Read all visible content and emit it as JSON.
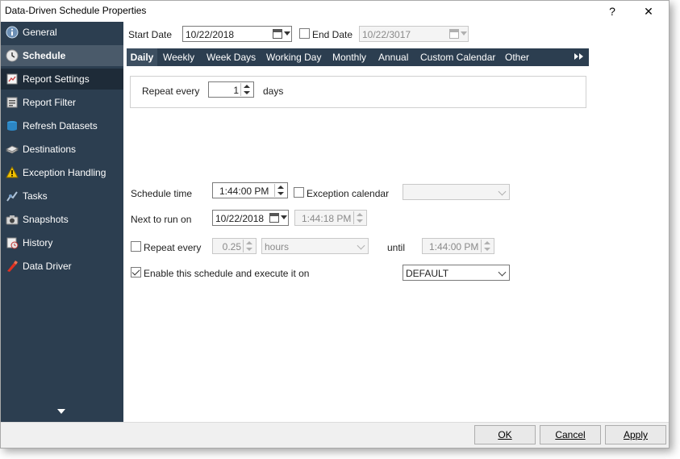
{
  "window": {
    "title": "Data-Driven Schedule Properties",
    "help_label": "?",
    "close_label": "✕"
  },
  "sidebar": {
    "items": [
      {
        "label": "General",
        "icon": "info-icon"
      },
      {
        "label": "Schedule",
        "icon": "clock-icon"
      },
      {
        "label": "Report Settings",
        "icon": "report-icon"
      },
      {
        "label": "Report Filter",
        "icon": "filter-icon"
      },
      {
        "label": "Refresh Datasets",
        "icon": "refresh-icon"
      },
      {
        "label": "Destinations",
        "icon": "destinations-icon"
      },
      {
        "label": "Exception Handling",
        "icon": "warning-icon"
      },
      {
        "label": "Tasks",
        "icon": "tasks-icon"
      },
      {
        "label": "Snapshots",
        "icon": "camera-icon"
      },
      {
        "label": "History",
        "icon": "history-icon"
      },
      {
        "label": "Data Driver",
        "icon": "data-driver-icon"
      }
    ]
  },
  "schedule": {
    "start_date_label": "Start Date",
    "start_date_value": "10/22/2018",
    "end_date_label": "End Date",
    "end_date_value": "10/22/3017",
    "tabs": [
      "Daily",
      "Weekly",
      "Week Days",
      "Working Day",
      "Monthly",
      "Annual",
      "Custom Calendar",
      "Other"
    ],
    "repeat_every_label": "Repeat every",
    "repeat_every_value": "1",
    "repeat_unit_label": "days",
    "schedule_time_label": "Schedule time",
    "schedule_time_value": "1:44:00 PM",
    "exception_calendar_label": "Exception calendar",
    "exception_calendar_value": "",
    "next_to_run_label": "Next to run on",
    "next_to_run_date": "10/22/2018",
    "next_to_run_time": "1:44:18 PM",
    "repeat_interval_label": "Repeat every",
    "repeat_interval_value": "0.25",
    "repeat_interval_unit": "hours",
    "until_label": "until",
    "until_value": "1:44:00 PM",
    "enable_label": "Enable this schedule and execute it on",
    "enable_checked": true,
    "execute_on_value": "DEFAULT"
  },
  "footer": {
    "ok_label": "OK",
    "cancel_label": "Cancel",
    "apply_label": "Apply"
  },
  "colors": {
    "sidebar_bg": "#2c3e50",
    "sidebar_active": "#4a5a6a",
    "tabbar_bg": "#2c3e50"
  }
}
